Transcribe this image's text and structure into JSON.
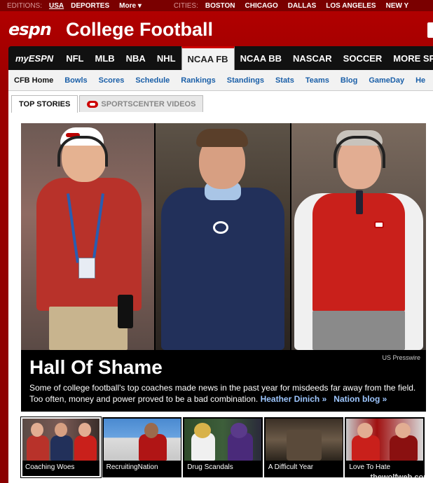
{
  "topbar": {
    "editions_label": "EDITIONS:",
    "editions": [
      "USA",
      "DEPORTES"
    ],
    "more_label": "More",
    "cities_label": "CITIES:",
    "cities": [
      "BOSTON",
      "CHICAGO",
      "DALLAS",
      "LOS ANGELES",
      "NEW Y"
    ]
  },
  "header": {
    "logo_text": "espn",
    "section_title": "College Football"
  },
  "mainnav": {
    "items": [
      "myESPN",
      "NFL",
      "MLB",
      "NBA",
      "NHL",
      "NCAA FB",
      "NCAA BB",
      "NASCAR",
      "SOCCER",
      "MORE SPO"
    ],
    "active": "NCAA FB"
  },
  "subnav": {
    "items": [
      "CFB Home",
      "Bowls",
      "Scores",
      "Schedule",
      "Rankings",
      "Standings",
      "Stats",
      "Teams",
      "Blog",
      "GameDay",
      "He"
    ]
  },
  "tabs": {
    "top_stories": "TOP STORIES",
    "sportscenter": "SPORTSCENTER VIDEOS"
  },
  "hero": {
    "credit": "US Presswire",
    "headline": "Hall Of Shame",
    "blurb": "Some of college football's top coaches made news in the past year for misdeeds far away from the field. Too often, money and power proved to be a bad combination.",
    "link_author": "Heather Dinich »",
    "link_blog": "Nation blog »"
  },
  "thumbs": [
    "Coaching Woes",
    "RecruitingNation",
    "Drug Scandals",
    "A Difficult Year",
    "Love To Hate"
  ],
  "watermark": "thewolfweb.com",
  "colors": {
    "brand_red": "#b40000",
    "nav_black": "#111111",
    "link_blue": "#1a5fa8"
  }
}
